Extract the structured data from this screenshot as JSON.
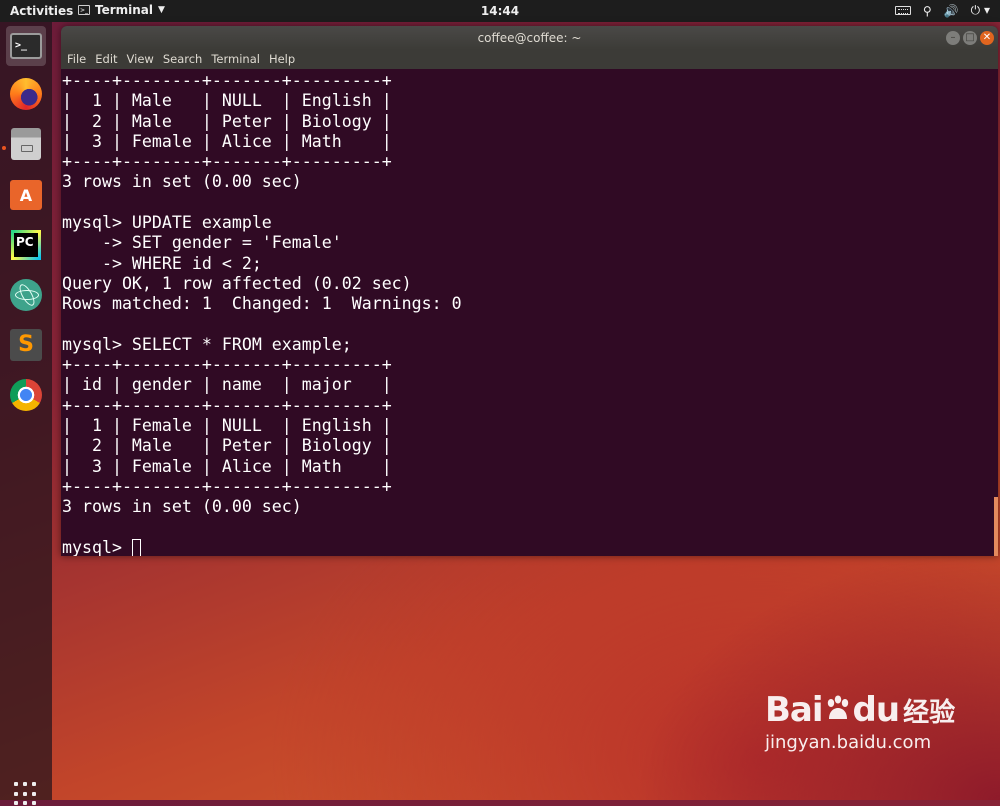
{
  "topbar": {
    "activities": "Activities",
    "app_name": "Terminal",
    "clock": "14:44"
  },
  "dock": {
    "apps": [
      "terminal-icon",
      "firefox-icon",
      "files-icon",
      "software-store-icon",
      "pycharm-icon",
      "atom-icon",
      "sublime-text-icon",
      "chrome-icon"
    ],
    "pycharm_text": "PC",
    "store_text": "A"
  },
  "window": {
    "title": "coffee@coffee: ~",
    "menu": [
      "File",
      "Edit",
      "View",
      "Search",
      "Terminal",
      "Help"
    ]
  },
  "terminal": {
    "lines": [
      "+----+--------+-------+---------+",
      "|  1 | Male   | NULL  | English |",
      "|  2 | Male   | Peter | Biology |",
      "|  3 | Female | Alice | Math    |",
      "+----+--------+-------+---------+",
      "3 rows in set (0.00 sec)",
      "",
      "mysql> UPDATE example",
      "    -> SET gender = 'Female'",
      "    -> WHERE id < 2;",
      "Query OK, 1 row affected (0.02 sec)",
      "Rows matched: 1  Changed: 1  Warnings: 0",
      "",
      "mysql> SELECT * FROM example;",
      "+----+--------+-------+---------+",
      "| id | gender | name  | major   |",
      "+----+--------+-------+---------+",
      "|  1 | Female | NULL  | English |",
      "|  2 | Male   | Peter | Biology |",
      "|  3 | Female | Alice | Math    |",
      "+----+--------+-------+---------+",
      "3 rows in set (0.00 sec)",
      ""
    ],
    "prompt": "mysql> "
  },
  "watermark": {
    "brand_left": "Bai",
    "brand_right": "du",
    "brand_cn": "经验",
    "url": "jingyan.baidu.com"
  }
}
